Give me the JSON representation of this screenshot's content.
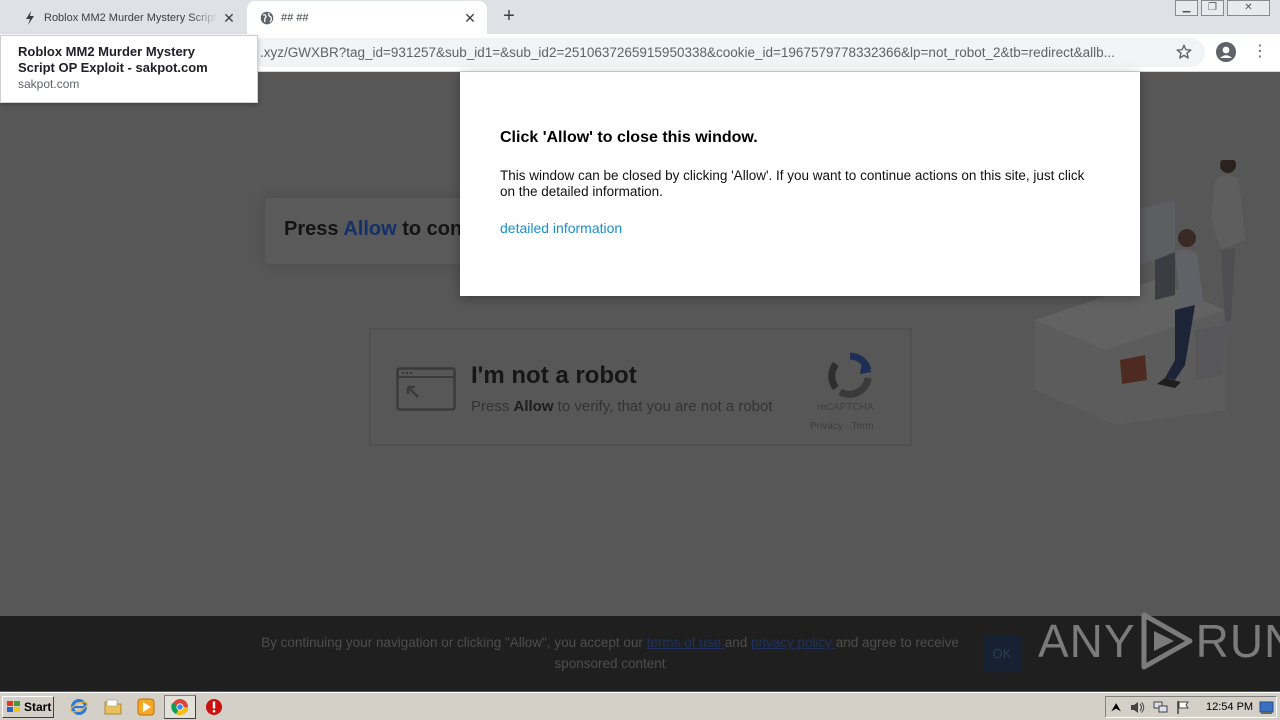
{
  "browser": {
    "tabs": [
      {
        "title": "Roblox MM2 Murder Mystery Script OP Exploit - sakpot.com",
        "icon": "lightning-icon",
        "active": false
      },
      {
        "title": "## ##",
        "icon": "globe-icon",
        "active": true
      }
    ],
    "url": ".xyz/GWXBR?tag_id=931257&sub_id1=&sub_id2=2510637265915950338&cookie_id=1967579778332366&lp=not_robot_2&tb=redirect&allb...",
    "tooltip": {
      "title": "Roblox MM2 Murder Mystery Script OP Exploit - sakpot.com",
      "domain": "sakpot.com"
    }
  },
  "page": {
    "press_heading": {
      "before": "Press ",
      "allow": "Allow",
      "after": " to con"
    },
    "captcha": {
      "title": "I'm not a robot",
      "sub_before": "Press ",
      "sub_bold": "Allow",
      "sub_after": " to verify, that you are not a robot",
      "brand": "reCAPTCHA",
      "links": "Privacy - Term"
    },
    "consent": {
      "before": "By continuing your navigation or clicking \"Allow\", you accept our ",
      "terms": "terms of use ",
      "and": "and ",
      "privacy": "privacy policy ",
      "after": "and agree to receive sponsored content",
      "ok": "OK"
    }
  },
  "modal": {
    "title": "Click 'Allow' to close this window.",
    "body": "This window can be closed by clicking 'Allow'. If you want to continue actions on this site, just click on the detailed information.",
    "link": "detailed information"
  },
  "watermark": {
    "left": "ANY",
    "right": "RUN"
  },
  "taskbar": {
    "start": "Start",
    "clock": "12:54 PM"
  },
  "colors": {
    "link_blue": "#1a8fc9",
    "overlay_dark": "#575757",
    "consent_bar": "#1f1f1f"
  }
}
